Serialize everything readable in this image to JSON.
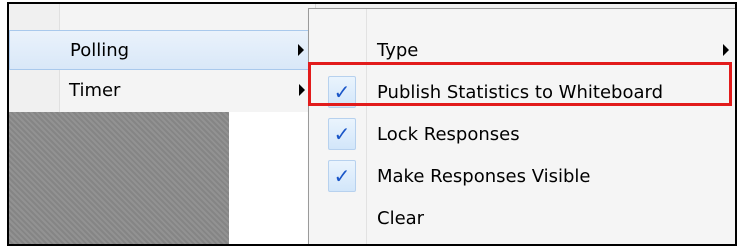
{
  "parent_menu": {
    "items": [
      {
        "label": "Polling",
        "has_submenu": true,
        "highlighted": true
      },
      {
        "label": "Timer",
        "has_submenu": true,
        "highlighted": false
      }
    ]
  },
  "submenu": {
    "items": [
      {
        "label": "Type",
        "checked": false,
        "has_submenu": true
      },
      {
        "label": "Publish Statistics to Whiteboard",
        "checked": true,
        "has_submenu": false,
        "annotated": true
      },
      {
        "label": "Lock Responses",
        "checked": true,
        "has_submenu": false
      },
      {
        "label": "Make Responses Visible",
        "checked": true,
        "has_submenu": false
      },
      {
        "label": "Clear",
        "checked": false,
        "has_submenu": false
      }
    ],
    "check_glyph": "✓"
  },
  "colors": {
    "annotation_border": "#e21b1b",
    "check_color": "#1a56c8"
  }
}
